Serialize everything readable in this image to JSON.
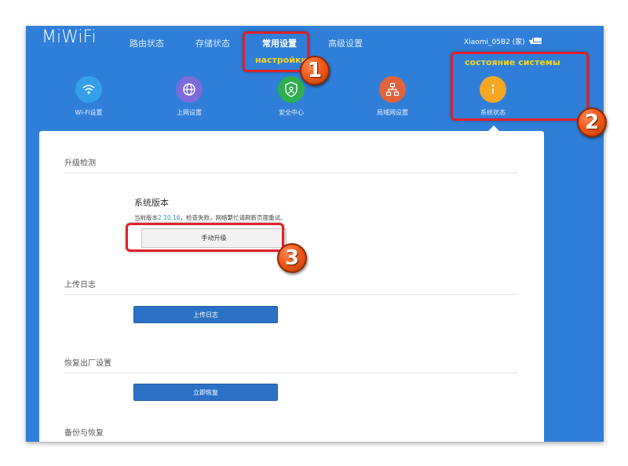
{
  "brand": "MiWiFi",
  "nav": [
    {
      "label": "路由状态"
    },
    {
      "label": "存储状态"
    },
    {
      "label": "常用设置",
      "active": true,
      "annotation": "настройки"
    },
    {
      "label": "高级设置"
    }
  ],
  "user": {
    "name": "Xiaomi_05B2 (家)"
  },
  "icons": [
    {
      "label": "Wi-Fi设置",
      "icon": "wifi-icon",
      "color": "#35a0ea"
    },
    {
      "label": "上网设置",
      "icon": "globe-icon",
      "color": "#7c6bd8"
    },
    {
      "label": "安全中心",
      "icon": "shield-icon",
      "color": "#2fae4e"
    },
    {
      "label": "局域网设置",
      "icon": "network-icon",
      "color": "#e2623b"
    },
    {
      "label": "系统状态",
      "icon": "info-icon",
      "color": "#f5a623",
      "annotation": "состояние системы"
    }
  ],
  "sections": {
    "upgrade": {
      "title": "升级检测",
      "version_title": "系统版本",
      "version_prefix": "当前版本",
      "version": "2.10.16",
      "version_suffix": "，检查失败，网络繁忙请刷新页面重试。",
      "button": "手动升级"
    },
    "log": {
      "title": "上传日志",
      "button": "上传日志"
    },
    "restore": {
      "title": "恢复出厂设置",
      "button": "立即恢复"
    },
    "backup": {
      "title": "备份与恢复"
    }
  },
  "markers": [
    "1",
    "2",
    "3"
  ],
  "colors": {
    "header_bg": "#2f7fd8",
    "highlight": "#e0212b",
    "annotation_text": "#f7d51d",
    "marker": "#f05a1a"
  }
}
